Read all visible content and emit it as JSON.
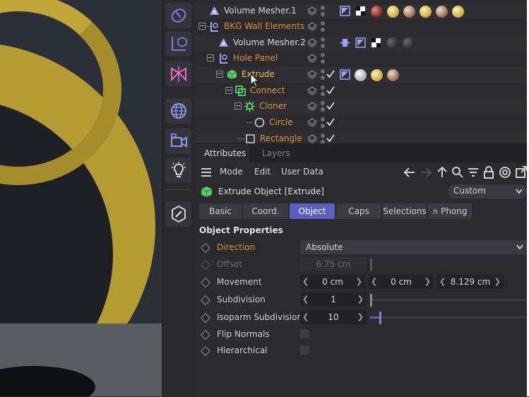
{
  "colors": {
    "accent": "#5a5fc1",
    "orange": "#e0902e",
    "panel": "#2b2b2f"
  },
  "toolbar": {
    "icons": [
      "sphere-tool-icon",
      "axis-cube-icon",
      "symmetry-icon",
      "globe-icon",
      "camera-icon",
      "light-bulb-icon",
      "edit-pen-icon"
    ]
  },
  "objects": [
    {
      "name": "Volume Mesher.1",
      "color": "white",
      "icon": "volume-mesher-icon"
    },
    {
      "name": "BKG Wall Elements",
      "color": "orange",
      "icon": "null-icon"
    },
    {
      "name": "Volume Mesher.2",
      "color": "white",
      "icon": "volume-mesher-icon"
    },
    {
      "name": "Hole Panel",
      "color": "orange",
      "icon": "null-icon"
    },
    {
      "name": "Extrude",
      "color": "orange",
      "icon": "extrude-cube-icon"
    },
    {
      "name": "Connect",
      "color": "orange",
      "icon": "connect-icon"
    },
    {
      "name": "Cloner",
      "color": "orange",
      "icon": "cloner-icon"
    },
    {
      "name": "Circle",
      "color": "orange",
      "icon": "circle-spline-icon"
    },
    {
      "name": "Rectangle",
      "color": "orange",
      "icon": "rectangle-spline-icon"
    }
  ],
  "attributes": {
    "tabs": [
      "Attributes",
      "Layers"
    ],
    "menu": [
      "Mode",
      "Edit",
      "User Data"
    ],
    "title": "Extrude Object [Extrude]",
    "preset": "Custom",
    "subtabs": [
      "Basic",
      "Coord.",
      "Object",
      "Caps",
      "Selections",
      "Phong"
    ],
    "active_subtab": "Object",
    "section": "Object Properties",
    "direction_label": "Direction",
    "direction_value": "Absolute",
    "offset_label": "Offset",
    "offset_value": "6.75 cm",
    "movement_label": "Movement",
    "movement_x": "0 cm",
    "movement_y": "0 cm",
    "movement_z": "8.129 cm",
    "subdivision_label": "Subdivision",
    "subdivision_value": "1",
    "isoparm_label": "Isoparm Subdivision",
    "isoparm_value": "10",
    "flip_label": "Flip Normals",
    "flip_checked": false,
    "hierarchical_label": "Hierarchical",
    "hierarchical_checked": false
  }
}
